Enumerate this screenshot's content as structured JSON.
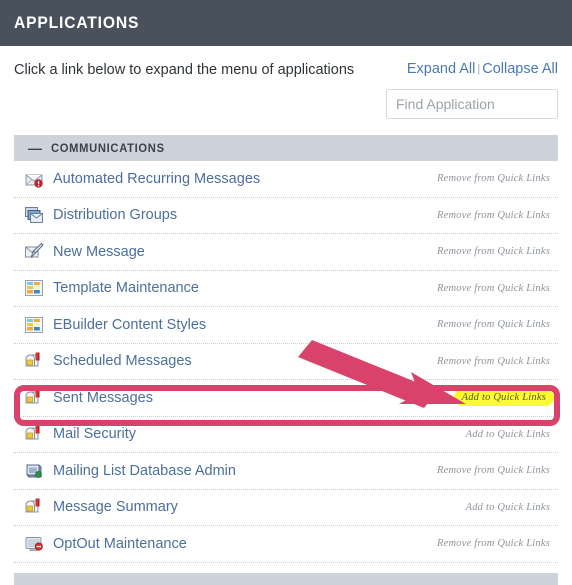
{
  "header": {
    "title": "APPLICATIONS",
    "bg_color": "#49525c"
  },
  "intro": {
    "text": "Click a link below to expand the menu of applications",
    "expand_all": "Expand All",
    "separator": "|",
    "collapse_all": "Collapse All",
    "link_color": "#4a78b5"
  },
  "search": {
    "placeholder": "Find Application",
    "value": ""
  },
  "section": {
    "toggle_glyph": "—",
    "title": "COMMUNICATIONS",
    "bg_color": "#ccd3da",
    "expanded": true
  },
  "applications": [
    {
      "label": "Automated Recurring Messages",
      "icon": "envelope-alert-icon",
      "action": "Remove from Quick Links",
      "highlighted": false
    },
    {
      "label": "Distribution Groups",
      "icon": "distribution-groups-icon",
      "action": "Remove from Quick Links",
      "highlighted": false
    },
    {
      "label": "New Message",
      "icon": "new-message-icon",
      "action": "Remove from Quick Links",
      "highlighted": false
    },
    {
      "label": "Template Maintenance",
      "icon": "template-grid-icon",
      "action": "Remove from Quick Links",
      "highlighted": false
    },
    {
      "label": "EBuilder Content Styles",
      "icon": "template-grid-icon",
      "action": "Remove from Quick Links",
      "highlighted": false
    },
    {
      "label": "Scheduled Messages",
      "icon": "mailbox-icon",
      "action": "Remove from Quick Links",
      "highlighted": false
    },
    {
      "label": "Sent Messages",
      "icon": "mailbox-icon",
      "action": "Add to Quick Links",
      "highlighted": true
    },
    {
      "label": "Mail Security",
      "icon": "mailbox-icon",
      "action": "Add to Quick Links",
      "highlighted": false
    },
    {
      "label": "Mailing List Database Admin",
      "icon": "database-admin-icon",
      "action": "Remove from Quick Links",
      "highlighted": false
    },
    {
      "label": "Message Summary",
      "icon": "mailbox-icon",
      "action": "Add to Quick Links",
      "highlighted": false
    },
    {
      "label": "OptOut Maintenance",
      "icon": "optout-icon",
      "action": "Remove from Quick Links",
      "highlighted": false
    }
  ],
  "annotation": {
    "type": "callout",
    "color": "#d9436b",
    "highlight_color": "#fbfb32",
    "box_target": "Sent Messages",
    "arrow_points_to": "Add to Quick Links"
  }
}
